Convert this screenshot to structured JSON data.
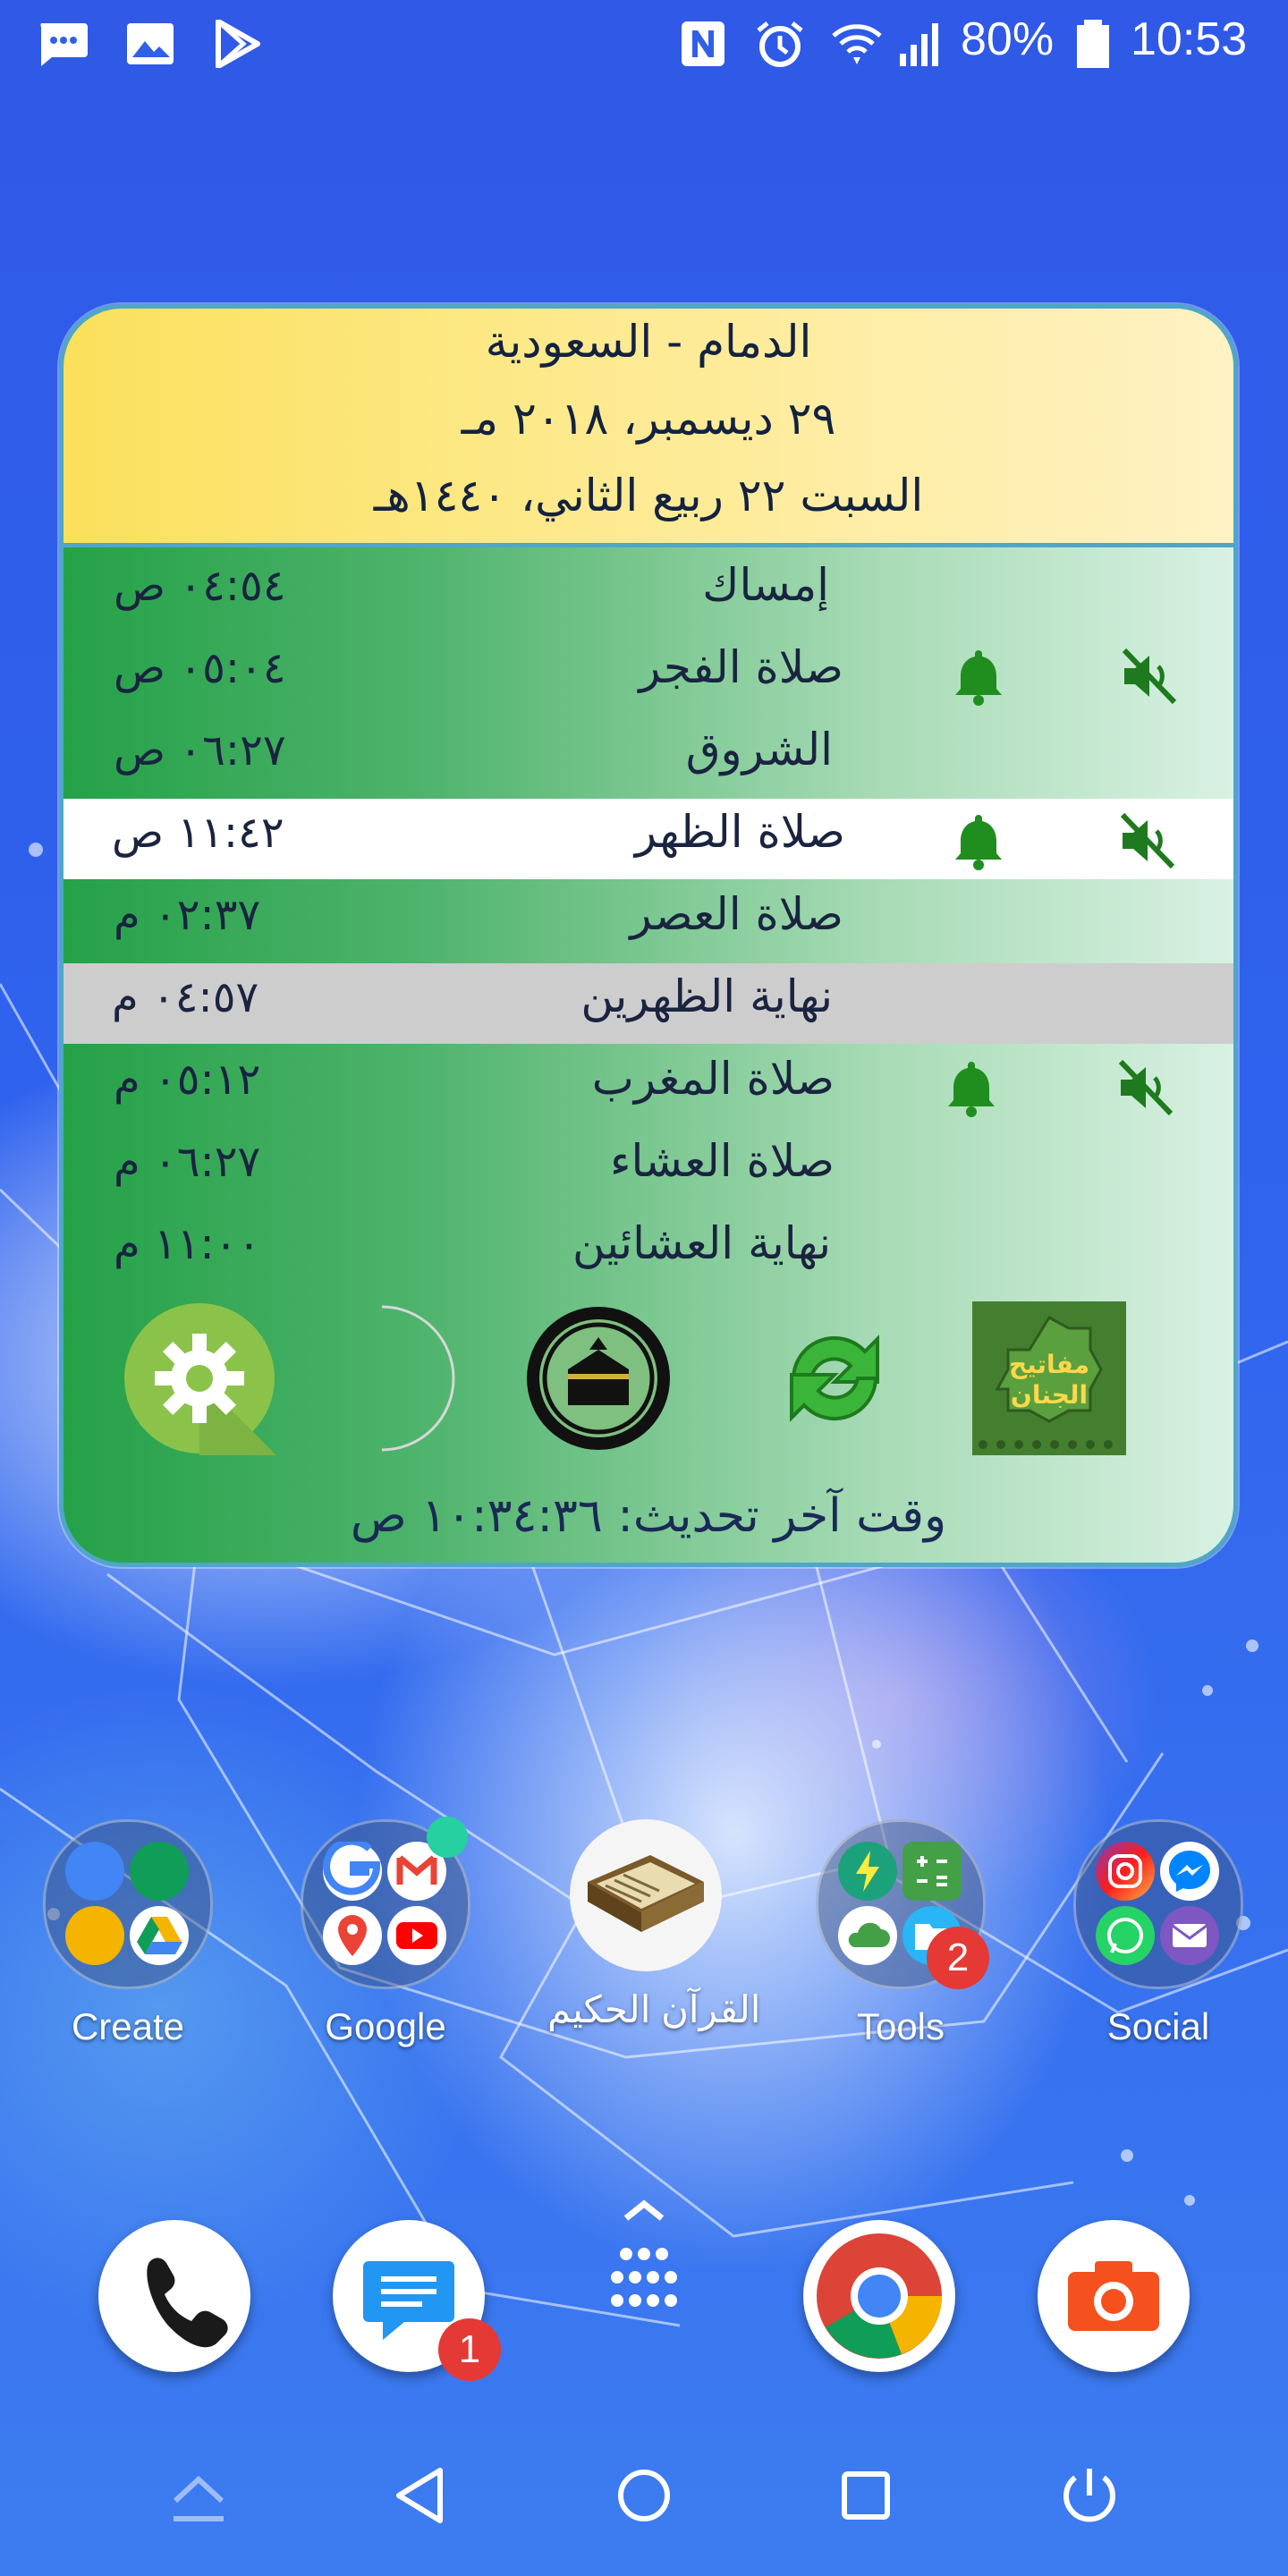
{
  "status_bar": {
    "battery": "80%",
    "time": "10:53",
    "left_icons": [
      "messages-icon",
      "gallery-icon",
      "play-store-icon"
    ],
    "right_icons": [
      "nfc-icon",
      "alarm-icon",
      "wifi-icon",
      "signal-icon",
      "battery-icon"
    ]
  },
  "widget": {
    "city": "الدمام - السعودية",
    "gregorian_date": "٢٩ ديسمبر، ٢٠١٨ مـ",
    "hijri_date": "السبت ٢٢ ربيع الثاني، ١٤٤٠هـ",
    "prayers": [
      {
        "name": "إمساك",
        "time": "٠٤:٥٤ ص"
      },
      {
        "name": "صلاة الفجر",
        "time": "٠٥:٠٤ ص"
      },
      {
        "name": "الشروق",
        "time": "٠٦:٢٧ ص"
      },
      {
        "name": "صلاة الظهر",
        "time": "١١:٤٢ ص"
      },
      {
        "name": "صلاة العصر",
        "time": "٠٢:٣٧ م"
      },
      {
        "name": "نهاية الظهرين",
        "time": "٠٤:٥٧ م"
      },
      {
        "name": "صلاة المغرب",
        "time": "٠٥:١٢ م"
      },
      {
        "name": "صلاة العشاء",
        "time": "٠٦:٢٧ م"
      },
      {
        "name": "نهاية العشائين",
        "time": "١١:٠٠ م"
      }
    ],
    "actions": [
      "settings-icon",
      "moon-icon",
      "kaaba-icon",
      "refresh-icon",
      "mafatih-al-jinan-icon"
    ],
    "mafatih_logo_text": "مفاتيح الجنان",
    "last_update": "وقت آخر تحديث: ١٠:٣٤:٣٦ ص",
    "colors": {
      "header": "#fde98a",
      "accent_green": "#27a148",
      "border": "#4fa6c9"
    }
  },
  "home": {
    "apps": [
      {
        "label": "Create"
      },
      {
        "label": "Google"
      },
      {
        "label": "القرآن الحكيم"
      },
      {
        "label": "Tools",
        "badge": "2"
      },
      {
        "label": "Social"
      }
    ],
    "dock": [
      {
        "name": "phone"
      },
      {
        "name": "messages",
        "badge": "1"
      },
      {
        "name": "app-drawer"
      },
      {
        "name": "chrome"
      },
      {
        "name": "camera"
      }
    ]
  },
  "nav_bar": [
    "up-icon",
    "back-icon",
    "home-icon",
    "recents-icon",
    "power-icon"
  ]
}
